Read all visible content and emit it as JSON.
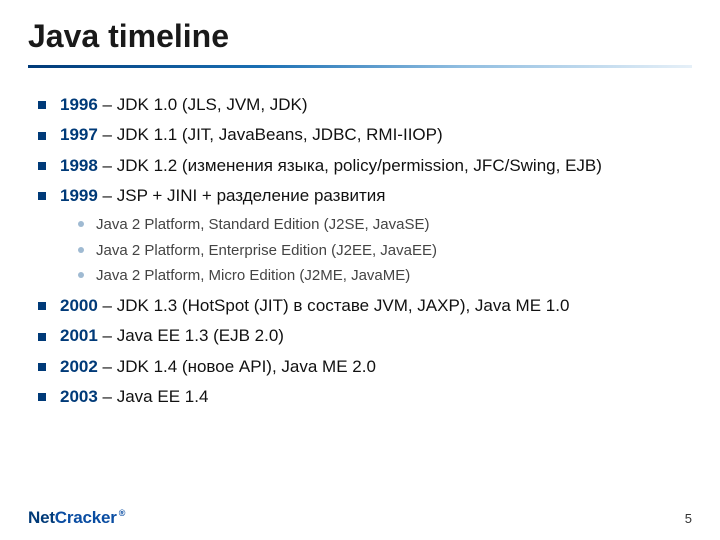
{
  "title": "Java timeline",
  "bullets": [
    {
      "year": "1996",
      "text": " – JDK 1.0 (JLS, JVM, JDK)"
    },
    {
      "year": "1997",
      "text": " – JDK 1.1 (JIT, JavaBeans, JDBC, RMI-IIOP)"
    },
    {
      "year": "1998",
      "text": " – JDK 1.2 (изменения языка, policy/permission, JFC/Swing, EJB)"
    },
    {
      "year": "1999",
      "text": " – JSP + JINI + разделение развития",
      "sub": [
        "Java 2 Platform, Standard Edition (J2SE, JavaSE)",
        "Java 2 Platform, Enterprise Edition (J2EE, JavaEE)",
        "Java 2 Platform, Micro Edition (J2ME, JavaME)"
      ]
    },
    {
      "year": "2000",
      "text": " – JDK 1.3 (HotSpot (JIT) в составе JVM, JAXP), Java ME 1.0"
    },
    {
      "year": "2001",
      "text": " – Java EE 1.3 (EJB 2.0)"
    },
    {
      "year": "2002",
      "text": " – JDK 1.4 (новое API), Java ME 2.0"
    },
    {
      "year": "2003",
      "text": " – Java EE 1.4"
    }
  ],
  "footer": {
    "logo_net": "Net",
    "logo_cracker": "Cracker",
    "logo_r": "®",
    "page": "5"
  }
}
